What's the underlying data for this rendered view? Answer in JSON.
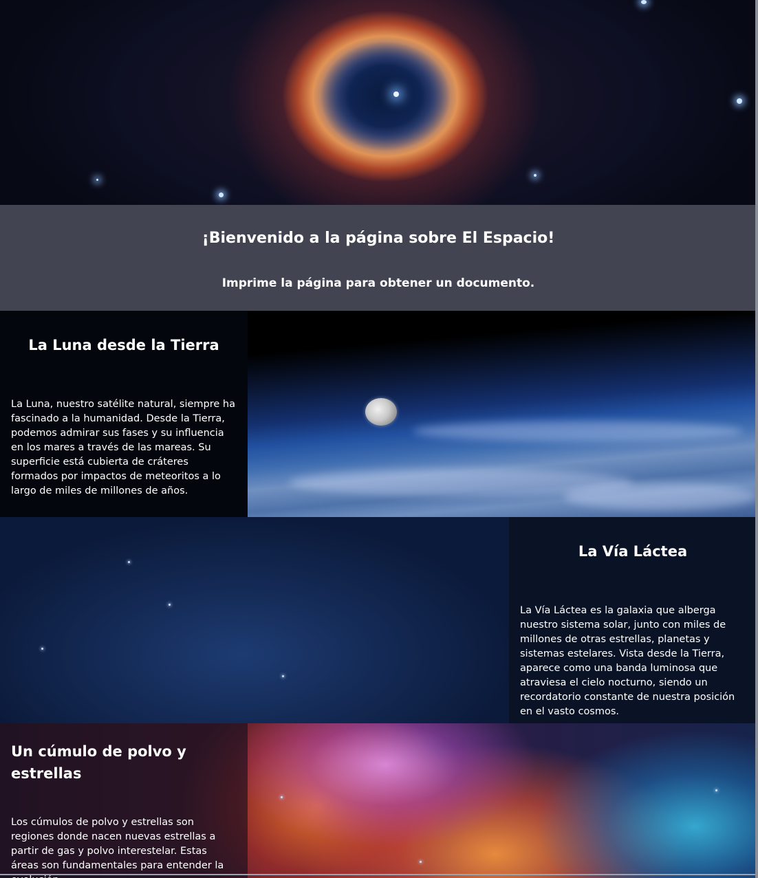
{
  "welcome": {
    "title": "¡Bienvenido a la página sobre El Espacio!",
    "subtitle": "Imprime la página para obtener un documento."
  },
  "sections": [
    {
      "title": "La Luna desde la Tierra",
      "body": "La Luna, nuestro satélite natural, siempre ha fascinado a la humanidad. Desde la Tierra, podemos admirar sus fases y su influencia en los mares a través de las mareas. Su superficie está cubierta de cráteres formados por impactos de meteoritos a lo largo de miles de millones de años."
    },
    {
      "title": "La Vía Láctea",
      "body": "La Vía Láctea es la galaxia que alberga nuestro sistema solar, junto con miles de millones de otras estrellas, planetas y sistemas estelares. Vista desde la Tierra, aparece como una banda luminosa que atraviesa el cielo nocturno, siendo un recordatorio constante de nuestra posición en el vasto cosmos."
    },
    {
      "title": "Un cúmulo de polvo y estrellas",
      "body": "Los cúmulos de polvo y estrellas son regiones donde nacen nuevas estrellas a partir de gas y polvo interestelar. Estas áreas son fundamentales para entender la evolución"
    }
  ]
}
